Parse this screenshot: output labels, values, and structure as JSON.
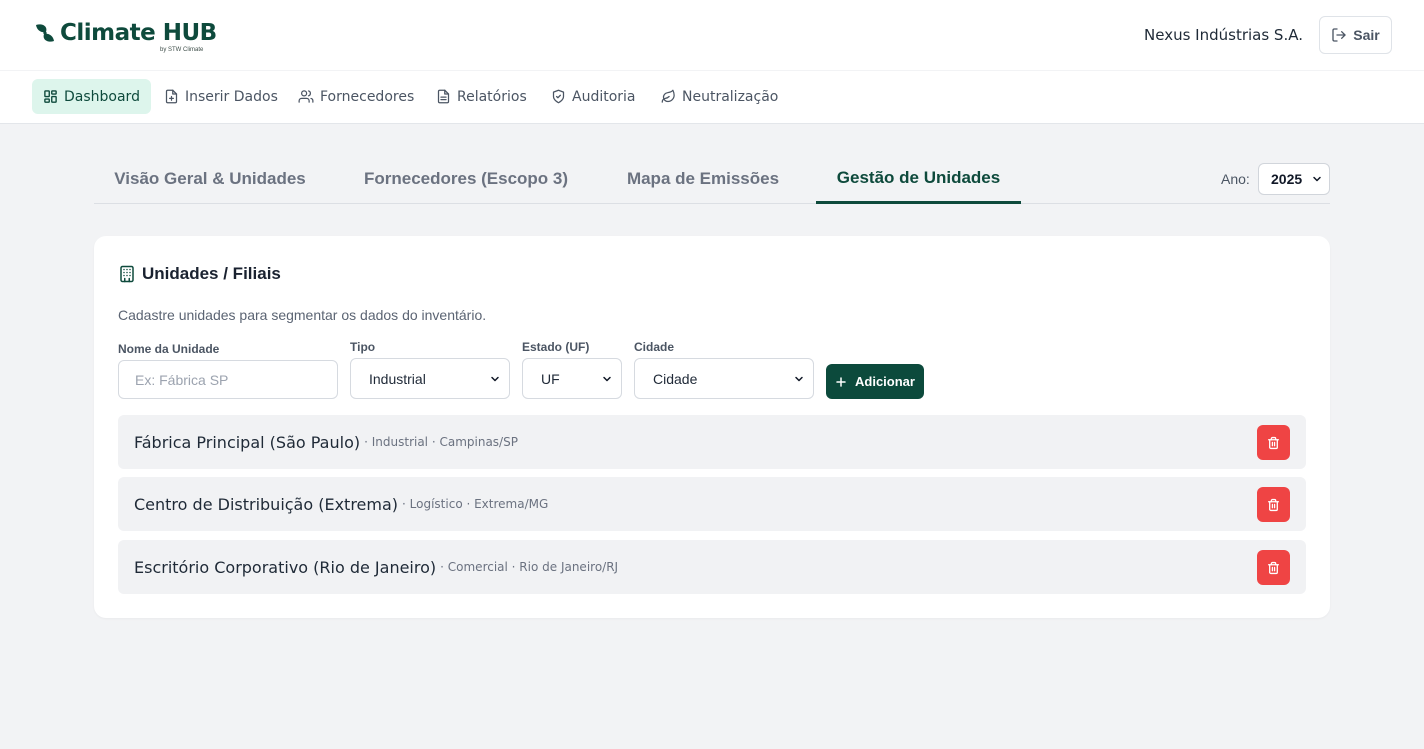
{
  "brand": {
    "name": "Climate HUB",
    "tagline": "by STW Climate",
    "color": "#0e4a3c"
  },
  "header": {
    "company": "Nexus Indústrias S.A.",
    "logout_label": "Sair",
    "logout_icon": "log-out-icon"
  },
  "nav": {
    "items": [
      {
        "label": "Dashboard",
        "icon": "layout-grid-icon",
        "active": true
      },
      {
        "label": "Inserir Dados",
        "icon": "file-plus-icon"
      },
      {
        "label": "Fornecedores",
        "icon": "users-icon"
      },
      {
        "label": "Relatórios",
        "icon": "file-text-icon"
      },
      {
        "label": "Auditoria",
        "icon": "shield-icon"
      },
      {
        "label": "Neutralização",
        "icon": "leaf-icon"
      }
    ]
  },
  "tabs": [
    {
      "label": "Visão Geral & Unidades"
    },
    {
      "label": "Fornecedores (Escopo 3)"
    },
    {
      "label": "Mapa de Emissões"
    },
    {
      "label": "Gestão de Unidades",
      "active": true
    }
  ],
  "year": {
    "label": "Ano:",
    "selected": "2025"
  },
  "units_card": {
    "title": "Unidades / Filiais",
    "icon": "building-icon",
    "description": "Cadastre unidades para segmentar os dados do inventário.",
    "form": {
      "name_label": "Nome da Unidade",
      "name_placeholder": "Ex: Fábrica SP",
      "type_label": "Tipo",
      "type_selected": "Industrial",
      "state_label": "Estado (UF)",
      "state_selected": "UF",
      "city_label": "Cidade",
      "city_selected": "Cidade",
      "add_label": "Adicionar"
    },
    "units": [
      {
        "name": "Fábrica Principal (São Paulo)",
        "meta": "· Industrial · Campinas/SP"
      },
      {
        "name": "Centro de Distribuição (Extrema)",
        "meta": "· Logístico · Extrema/MG"
      },
      {
        "name": "Escritório Corporativo (Rio de Janeiro)",
        "meta": "· Comercial · Rio de Janeiro/RJ"
      }
    ],
    "delete_color": "#ef4444"
  }
}
